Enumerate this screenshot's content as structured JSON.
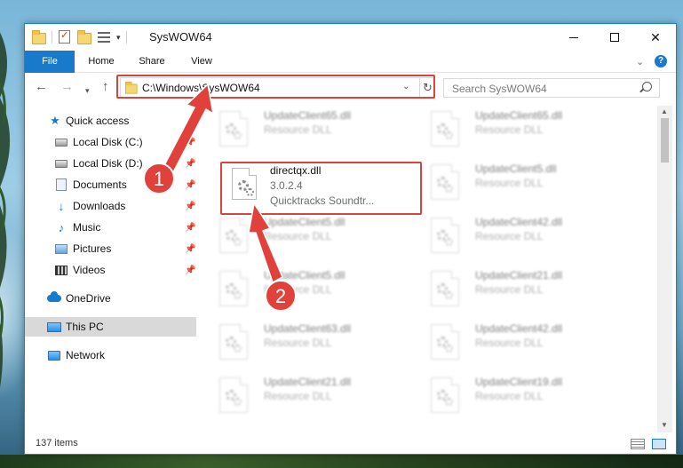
{
  "window": {
    "title": "SysWOW64",
    "controls": {
      "minimize": "minimize-icon",
      "maximize": "maximize-icon",
      "close": "✕"
    }
  },
  "ribbon": {
    "tabs": [
      "File",
      "Home",
      "Share",
      "View"
    ],
    "expand_glyph": "⌄",
    "help_glyph": "?"
  },
  "navigation": {
    "address": "C:\\Windows\\SysWOW64",
    "search_placeholder": "Search SysWOW64",
    "refresh_glyph": "↻"
  },
  "sidebar": {
    "items": [
      {
        "label": "Quick access",
        "icon": "star-icon",
        "pinned": false
      },
      {
        "label": "Local Disk (C:)",
        "icon": "drive-icon",
        "pinned": true
      },
      {
        "label": "Local Disk (D:)",
        "icon": "drive-icon",
        "pinned": true
      },
      {
        "label": "Documents",
        "icon": "documents-icon",
        "pinned": true
      },
      {
        "label": "Downloads",
        "icon": "downloads-icon",
        "pinned": true
      },
      {
        "label": "Music",
        "icon": "music-icon",
        "pinned": true
      },
      {
        "label": "Pictures",
        "icon": "pictures-icon",
        "pinned": true
      },
      {
        "label": "Videos",
        "icon": "videos-icon",
        "pinned": true
      },
      {
        "label": "OneDrive",
        "icon": "onedrive-icon",
        "pinned": false
      },
      {
        "label": "This PC",
        "icon": "this-pc-icon",
        "pinned": false,
        "selected": true
      },
      {
        "label": "Network",
        "icon": "network-icon",
        "pinned": false
      }
    ]
  },
  "files": {
    "focus": {
      "name": "directqx.dll",
      "version": "3.0.2.4",
      "company": "Quicktracks Soundtr..."
    },
    "left_column": [
      {
        "name": "UpdateClient65.dll",
        "type": "Resource DLL"
      },
      {
        "name": "UpdateClient5.dll",
        "type": "Resource DLL"
      },
      {
        "name": "UpdateClient5.dll",
        "type": "Resource DLL"
      },
      {
        "name": "UpdateClient63.dll",
        "type": "Resource DLL"
      },
      {
        "name": "UpdateClient21.dll",
        "type": "Resource DLL"
      }
    ],
    "right_column": [
      {
        "name": "UpdateClient65.dll",
        "type": "Resource DLL"
      },
      {
        "name": "UpdateClient5.dll",
        "type": "Resource DLL"
      },
      {
        "name": "UpdateClient42.dll",
        "type": "Resource DLL"
      },
      {
        "name": "UpdateClient21.dll",
        "type": "Resource DLL"
      },
      {
        "name": "UpdateClient42.dll",
        "type": "Resource DLL"
      },
      {
        "name": "UpdateClient19.dll",
        "type": "Resource DLL"
      }
    ]
  },
  "status": {
    "item_count": "137 items"
  },
  "annotations": {
    "step1": "1",
    "step2": "2",
    "color": "#e0413a"
  }
}
